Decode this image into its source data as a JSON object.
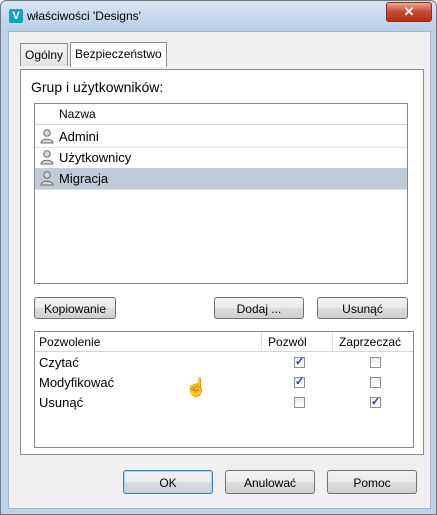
{
  "window": {
    "title": "właściwości 'Designs'",
    "close_glyph": "✕"
  },
  "tabs": [
    {
      "label": "Ogólny"
    },
    {
      "label": "Bezpieczeństwo"
    }
  ],
  "security": {
    "group_label": "Grup i użytkowników:",
    "list_header": "Nazwa",
    "users": [
      {
        "name": "Admini",
        "selected": false,
        "icon": "user-icon"
      },
      {
        "name": "Użytkownicy",
        "selected": false,
        "icon": "user-icon"
      },
      {
        "name": "Migracja",
        "selected": true,
        "icon": "user-icon"
      }
    ],
    "buttons": {
      "copy": "Kopiowanie",
      "add": "Dodaj ...",
      "remove": "Usunąć"
    },
    "perm_headers": {
      "permission": "Pozwolenie",
      "allow": "Pozwól",
      "deny": "Zaprzeczać"
    },
    "permissions": [
      {
        "name": "Czytać",
        "allow": true,
        "deny": false
      },
      {
        "name": "Modyfikować",
        "allow": true,
        "deny": false
      },
      {
        "name": "Usunąć",
        "allow": false,
        "deny": true
      }
    ]
  },
  "footer": {
    "ok": "OK",
    "cancel": "Anulować",
    "help": "Pomoc"
  },
  "colors": {
    "selected_row": "#c0cbd7",
    "check": "#21457d",
    "title_bar": "#bcd2e8"
  }
}
